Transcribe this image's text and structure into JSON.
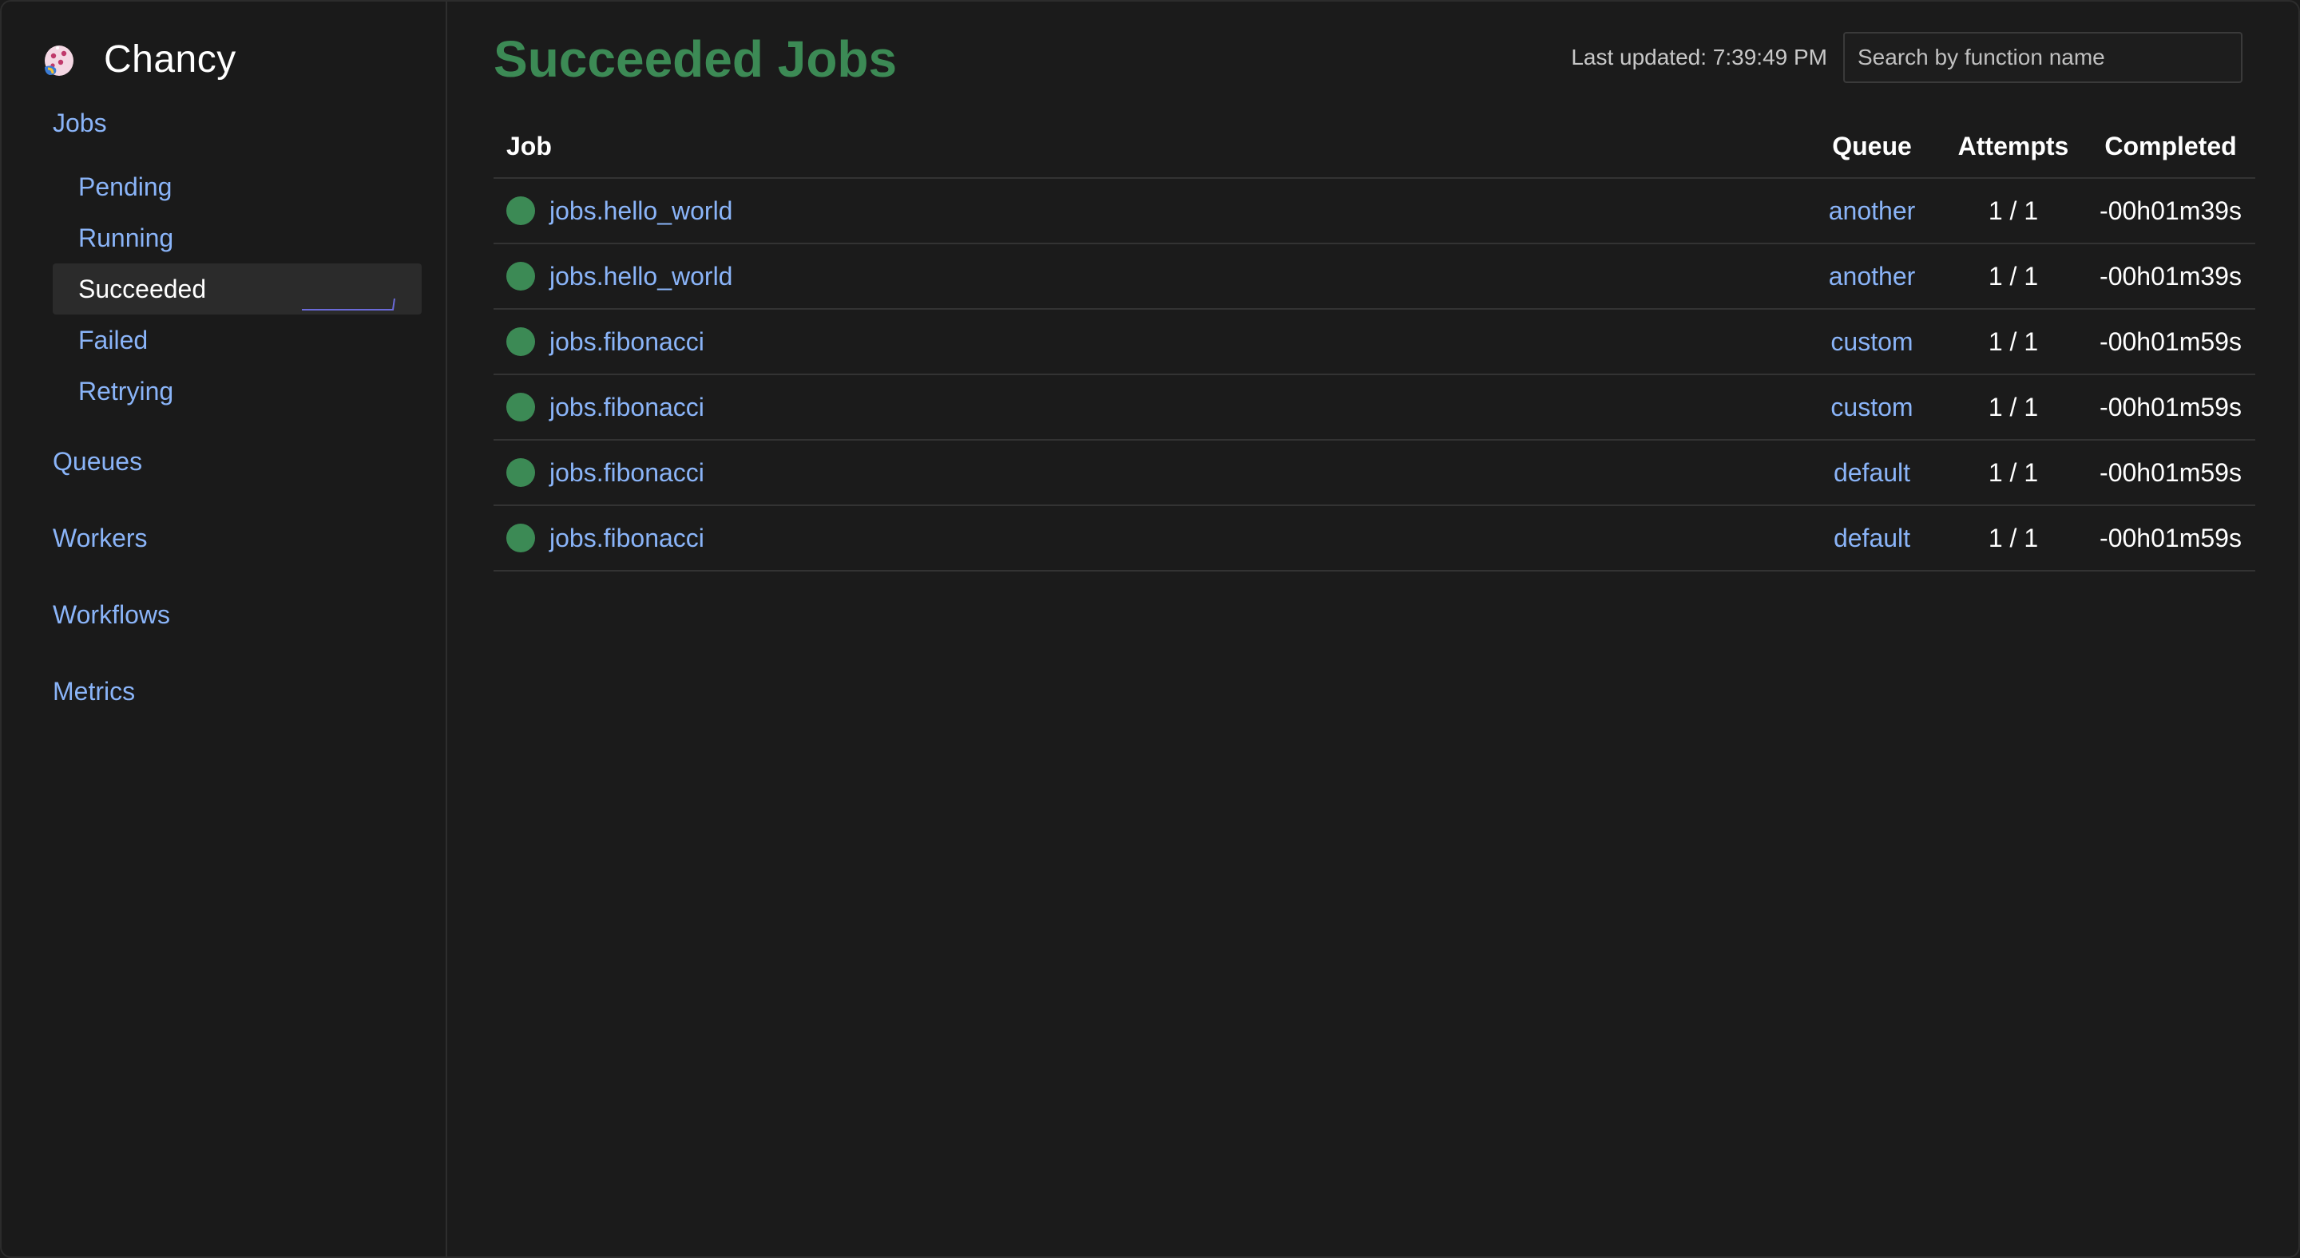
{
  "app": {
    "name": "Chancy"
  },
  "sidebar": {
    "jobs_label": "Jobs",
    "job_states": [
      {
        "label": "Pending"
      },
      {
        "label": "Running"
      },
      {
        "label": "Succeeded"
      },
      {
        "label": "Failed"
      },
      {
        "label": "Retrying"
      }
    ],
    "active_state": "Succeeded",
    "sections": [
      {
        "label": "Queues"
      },
      {
        "label": "Workers"
      },
      {
        "label": "Workflows"
      },
      {
        "label": "Metrics"
      }
    ]
  },
  "header": {
    "title": "Succeeded Jobs",
    "last_updated": "Last updated: 7:39:49 PM",
    "search_placeholder": "Search by function name",
    "search_value": ""
  },
  "table": {
    "columns": [
      "Job",
      "Queue",
      "Attempts",
      "Completed"
    ],
    "rows": [
      {
        "job": "jobs.hello_world",
        "queue": "another",
        "attempts": "1 / 1",
        "completed": "-00h01m39s",
        "status": "succeeded"
      },
      {
        "job": "jobs.hello_world",
        "queue": "another",
        "attempts": "1 / 1",
        "completed": "-00h01m39s",
        "status": "succeeded"
      },
      {
        "job": "jobs.fibonacci",
        "queue": "custom",
        "attempts": "1 / 1",
        "completed": "-00h01m59s",
        "status": "succeeded"
      },
      {
        "job": "jobs.fibonacci",
        "queue": "custom",
        "attempts": "1 / 1",
        "completed": "-00h01m59s",
        "status": "succeeded"
      },
      {
        "job": "jobs.fibonacci",
        "queue": "default",
        "attempts": "1 / 1",
        "completed": "-00h01m59s",
        "status": "succeeded"
      },
      {
        "job": "jobs.fibonacci",
        "queue": "default",
        "attempts": "1 / 1",
        "completed": "-00h01m59s",
        "status": "succeeded"
      }
    ]
  },
  "colors": {
    "background": "#1b1b1b",
    "link": "#8ab4f8",
    "success": "#3c8a55",
    "active_bg": "#2b2b2b"
  },
  "icons": {
    "logo": "chancy-logo-icon",
    "status": "success-dot-icon"
  }
}
